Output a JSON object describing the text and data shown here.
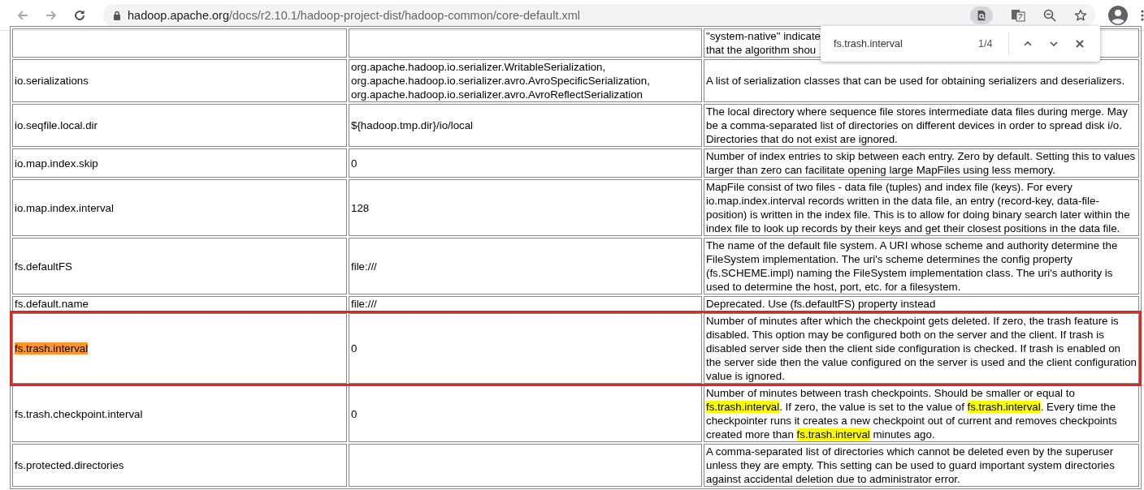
{
  "toolbar": {
    "url_host": "hadoop.apache.org",
    "url_path": "/docs/r2.10.1/hadoop-project-dist/hadoop-common/core-default.xml",
    "find_active": true
  },
  "find_bar": {
    "query": "fs.trash.interval",
    "count": "1/4"
  },
  "clipped_row": {
    "desc_lines": [
      "\"system-native\" indicate",
      "that the algorithm shou"
    ]
  },
  "rows": [
    {
      "name": "io.serializations",
      "current_match": false,
      "value": "org.apache.hadoop.io.serializer.WritableSerialization, org.apache.hadoop.io.serializer.avro.AvroSpecificSerialization, org.apache.hadoop.io.serializer.avro.AvroReflectSerialization",
      "desc": "A list of serialization classes that can be used for obtaining serializers and deserializers.",
      "outlined": false
    },
    {
      "name": "io.seqfile.local.dir",
      "current_match": false,
      "value": "${hadoop.tmp.dir}/io/local",
      "desc": "The local directory where sequence file stores intermediate data files during merge. May be a comma-separated list of directories on different devices in order to spread disk i/o. Directories that do not exist are ignored.",
      "outlined": false
    },
    {
      "name": "io.map.index.skip",
      "current_match": false,
      "value": "0",
      "desc": "Number of index entries to skip between each entry. Zero by default. Setting this to values larger than zero can facilitate opening large MapFiles using less memory.",
      "outlined": false
    },
    {
      "name": "io.map.index.interval",
      "current_match": false,
      "value": "128",
      "desc": "MapFile consist of two files - data file (tuples) and index file (keys). For every io.map.index.interval records written in the data file, an entry (record-key, data-file-position) is written in the index file. This is to allow for doing binary search later within the index file to look up records by their keys and get their closest positions in the data file.",
      "outlined": false
    },
    {
      "name": "fs.defaultFS",
      "current_match": false,
      "value": "file:///",
      "desc": "The name of the default file system. A URI whose scheme and authority determine the FileSystem implementation. The uri's scheme determines the config property (fs.SCHEME.impl) naming the FileSystem implementation class. The uri's authority is used to determine the host, port, etc. for a filesystem.",
      "outlined": false
    },
    {
      "name": "fs.default.name",
      "current_match": false,
      "value": "file:///",
      "desc": "Deprecated. Use (fs.defaultFS) property instead",
      "outlined": false
    },
    {
      "name": "fs.trash.interval",
      "current_match": true,
      "value": "0",
      "desc": "Number of minutes after which the checkpoint gets deleted. If zero, the trash feature is disabled. This option may be configured both on the server and the client. If trash is disabled server side then the client side configuration is checked. If trash is enabled on the server side then the value configured on the server is used and the client configuration value is ignored.",
      "outlined": true
    },
    {
      "name": "fs.trash.checkpoint.interval",
      "current_match": false,
      "value": "0",
      "desc_parts": [
        {
          "text": "Number of minutes between trash checkpoints. Should be smaller or equal to ",
          "highlighted": false
        },
        {
          "text": "fs.trash.interval",
          "highlighted": true
        },
        {
          "text": ". If zero, the value is set to the value of ",
          "highlighted": false
        },
        {
          "text": "fs.trash.interval",
          "highlighted": true
        },
        {
          "text": ". Every time the checkpointer runs it creates a new checkpoint out of current and removes checkpoints created more than ",
          "highlighted": false
        },
        {
          "text": "fs.trash.interval",
          "highlighted": true
        },
        {
          "text": " minutes ago.",
          "highlighted": false
        }
      ],
      "outlined": false
    },
    {
      "name": "fs.protected.directories",
      "current_match": false,
      "value": "",
      "desc": "A comma-separated list of directories which cannot be deleted even by the superuser unless they are empty. This setting can be used to guard important system directories against accidental deletion due to administrator error.",
      "outlined": false
    }
  ]
}
